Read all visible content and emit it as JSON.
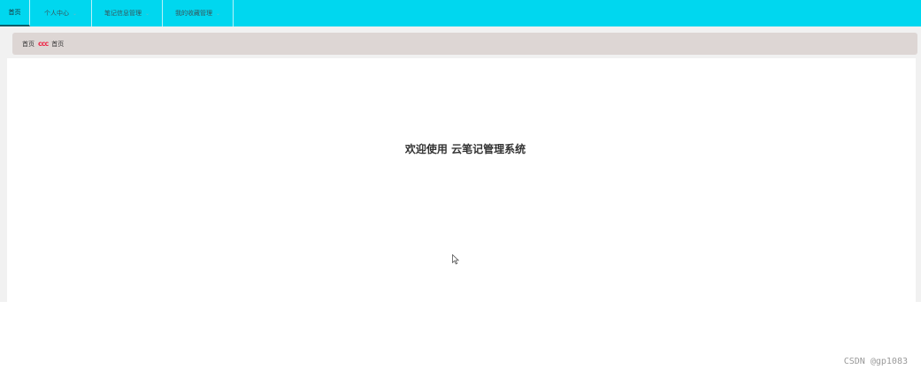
{
  "nav": {
    "items": [
      {
        "label": "首页",
        "chevron": ""
      },
      {
        "label": "个人中心",
        "chevron": "⌄"
      },
      {
        "label": "笔记信息管理",
        "chevron": "⌄"
      },
      {
        "label": "我的收藏管理",
        "chevron": "⌄"
      }
    ]
  },
  "breadcrumb": {
    "root": "首页",
    "separator": "ccc",
    "current": "首页"
  },
  "main": {
    "welcome": "欢迎使用 云笔记管理系统"
  },
  "watermark": "CSDN @gp1083",
  "colors": {
    "nav_bg": "#00d7ef",
    "breadcrumb_bg": "#ddd6d4",
    "separator": "#ee2a4a"
  }
}
